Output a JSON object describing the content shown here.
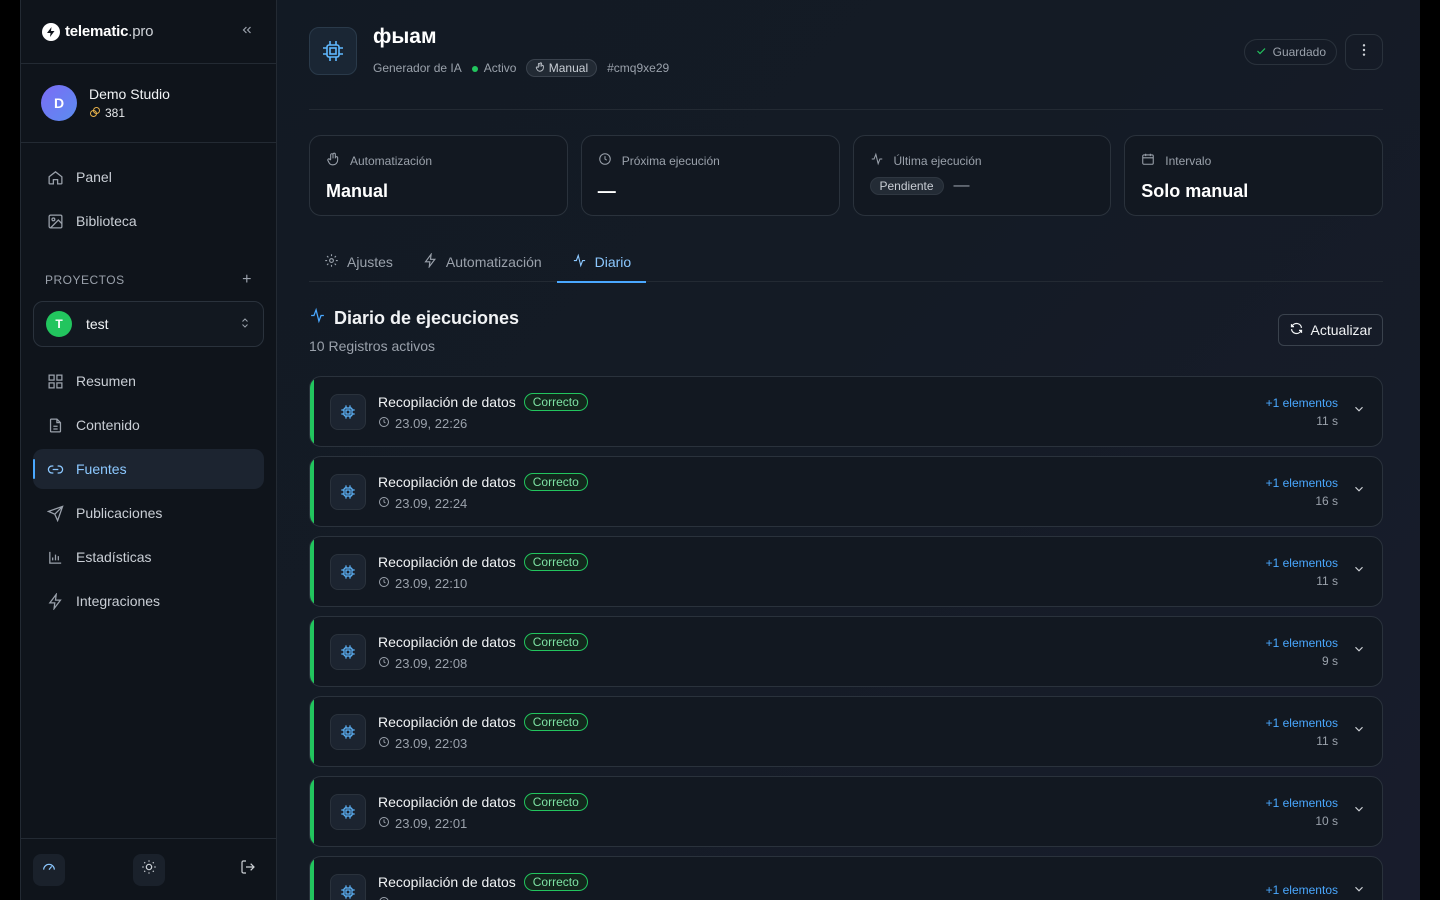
{
  "brand": {
    "name_bold": "telematic",
    "name_light": ".pro"
  },
  "profile": {
    "initial": "D",
    "name": "Demo Studio",
    "credits": "381"
  },
  "nav_top": [
    {
      "label": "Panel",
      "icon": "home-icon"
    },
    {
      "label": "Biblioteca",
      "icon": "image-icon"
    }
  ],
  "projects": {
    "label": "PROYECTOS",
    "selected": {
      "initial": "T",
      "name": "test"
    }
  },
  "nav_project": [
    {
      "label": "Resumen",
      "icon": "grid-icon"
    },
    {
      "label": "Contenido",
      "icon": "document-icon"
    },
    {
      "label": "Fuentes",
      "icon": "link-icon",
      "active": true
    },
    {
      "label": "Publicaciones",
      "icon": "send-icon"
    },
    {
      "label": "Estadísticas",
      "icon": "bar-chart-icon"
    },
    {
      "label": "Integraciones",
      "icon": "bolt-icon"
    }
  ],
  "header": {
    "title": "фыам",
    "type": "Generador de IA",
    "status": "Activo",
    "mode": "Manual",
    "id": "#cmq9xe29",
    "saved_label": "Guardado"
  },
  "stats": [
    {
      "label": "Automatización",
      "value": "Manual",
      "icon": "hand-icon"
    },
    {
      "label": "Próxima ejecución",
      "value": "—",
      "icon": "clock-icon"
    },
    {
      "label": "Última ejecución",
      "badge": "Pendiente",
      "value": "—",
      "icon": "activity-icon"
    },
    {
      "label": "Intervalo",
      "value": "Solo manual",
      "icon": "calendar-icon"
    }
  ],
  "tabs": [
    {
      "label": "Ajustes",
      "icon": "gear-icon"
    },
    {
      "label": "Automatización",
      "icon": "bolt-icon"
    },
    {
      "label": "Diario",
      "icon": "activity-icon",
      "active": true
    }
  ],
  "log": {
    "title": "Diario de ejecuciones",
    "subtitle": "10 Registros activos",
    "refresh_label": "Actualizar",
    "entries": [
      {
        "title": "Recopilación de datos",
        "status": "Correcto",
        "time": "23.09, 22:26",
        "count": "+1 elementos",
        "duration": "11 s"
      },
      {
        "title": "Recopilación de datos",
        "status": "Correcto",
        "time": "23.09, 22:24",
        "count": "+1 elementos",
        "duration": "16 s"
      },
      {
        "title": "Recopilación de datos",
        "status": "Correcto",
        "time": "23.09, 22:10",
        "count": "+1 elementos",
        "duration": "11 s"
      },
      {
        "title": "Recopilación de datos",
        "status": "Correcto",
        "time": "23.09, 22:08",
        "count": "+1 elementos",
        "duration": "9 s"
      },
      {
        "title": "Recopilación de datos",
        "status": "Correcto",
        "time": "23.09, 22:03",
        "count": "+1 elementos",
        "duration": "11 s"
      },
      {
        "title": "Recopilación de datos",
        "status": "Correcto",
        "time": "23.09, 22:01",
        "count": "+1 elementos",
        "duration": "10 s"
      },
      {
        "title": "Recopilación de datos",
        "status": "Correcto",
        "time": "",
        "count": "+1 elementos",
        "duration": ""
      }
    ]
  },
  "colors": {
    "accent": "#4aa8ff",
    "success": "#22c55e",
    "background": "#121a24"
  }
}
